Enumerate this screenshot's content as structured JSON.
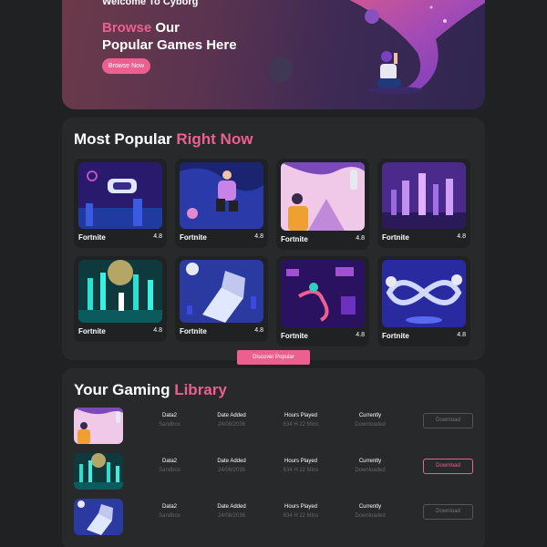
{
  "hero": {
    "welcome": "Welcome To Cyborg",
    "title_accent": "Browse",
    "title_rest_1": " Our",
    "title_line_2": "Popular Games Here",
    "button_label": "Browse Now"
  },
  "popular": {
    "title_main": "Most Popular ",
    "title_accent": "Right Now",
    "games": [
      {
        "name": "Fortnite",
        "rating": "4.8"
      },
      {
        "name": "Fortnite",
        "rating": "4.8"
      },
      {
        "name": "Fortnite",
        "rating": "4.8"
      },
      {
        "name": "Fortnite",
        "rating": "4.8"
      },
      {
        "name": "Fortnite",
        "rating": "4.8"
      },
      {
        "name": "Fortnite",
        "rating": "4.8"
      },
      {
        "name": "Fortnite",
        "rating": "4.8"
      },
      {
        "name": "Fortnite",
        "rating": "4.8"
      }
    ],
    "discover_label": "Discover Popular"
  },
  "library": {
    "title_main": "Your Gaming ",
    "title_accent": "Library",
    "rows": [
      {
        "name": "Data2",
        "name_sub": "Sandbox",
        "date_h": "Date Added",
        "date": "24/08/2036",
        "hours_h": "Hours Played",
        "hours": "634 H 22 Mins",
        "status_h": "Currently",
        "status": "Downloaded",
        "button": "Download"
      },
      {
        "name": "Data2",
        "name_sub": "Sandbox",
        "date_h": "Date Added",
        "date": "24/08/2036",
        "hours_h": "Hours Played",
        "hours": "634 H 22 Mins",
        "status_h": "Currently",
        "status": "Downloaded",
        "button": "Download"
      },
      {
        "name": "Data2",
        "name_sub": "Sandbox",
        "date_h": "Date Added",
        "date": "24/08/2036",
        "hours_h": "Hours Played",
        "hours": "634 H 22 Mins",
        "status_h": "Currently",
        "status": "Downloaded",
        "button": "Download"
      }
    ]
  },
  "colors": {
    "accent": "#ec6090",
    "background": "#1f2122",
    "card": "#27292a"
  }
}
